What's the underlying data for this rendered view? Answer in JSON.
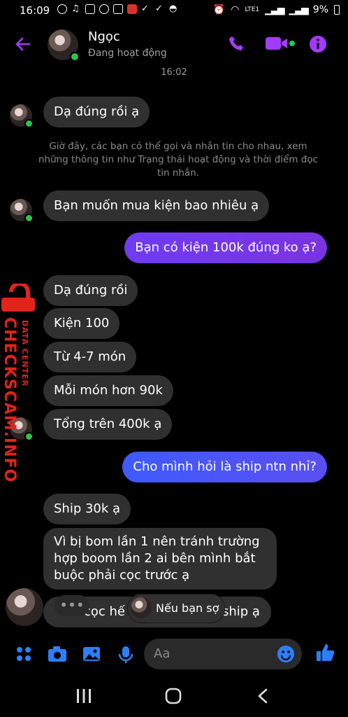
{
  "status_bar": {
    "time": "16:09",
    "battery": "9%",
    "network": "LTE1"
  },
  "header": {
    "name": "Ngọc",
    "status": "Đang hoạt động"
  },
  "timestamp": "16:02",
  "system_note": "Giờ đây, các bạn có thể gọi và nhắn tin cho nhau, xem những thông tin như Trạng thái hoạt động và thời điểm đọc tin nhắn.",
  "messages": [
    {
      "from": "them",
      "text": "Dạ đúng rồi ạ"
    },
    {
      "from": "them",
      "text": "Bạn muốn mua kiện bao nhiêu ạ"
    },
    {
      "from": "me",
      "text": "Bạn có kiện 100k đúng ko ạ?"
    },
    {
      "from": "them",
      "text": "Dạ đúng rồi"
    },
    {
      "from": "them",
      "text": "Kiện 100"
    },
    {
      "from": "them",
      "text": "Từ 4-7 món"
    },
    {
      "from": "them",
      "text": "Mỗi món hơn 90k"
    },
    {
      "from": "them",
      "text": "Tổng trên 400k ạ"
    },
    {
      "from": "me",
      "text": "Cho mình hỏi là ship ntn nhỉ?"
    },
    {
      "from": "them",
      "text": "Ship 30k ạ"
    },
    {
      "from": "them",
      "text_line1": "Vì bị bom lần 1 nên tránh trường",
      "text_line2": "hợp boom  lần 2 ai bên mình bắt",
      "text_line3": "buộc phải cọc trước ạ"
    },
    {
      "from": "them",
      "text_left": "cọc hế",
      "text_right": "ship ạ"
    }
  ],
  "typing_preview": "Nếu bạn sợ",
  "watermark": {
    "top": "DATA CENTER",
    "main": "CHECKSCAM.INFO"
  },
  "composer": {
    "placeholder": "Aa"
  },
  "colors": {
    "accent": "#a33bff",
    "blue": "#2d7ff9",
    "online": "#31c24a",
    "bubble_in": "#303030"
  }
}
